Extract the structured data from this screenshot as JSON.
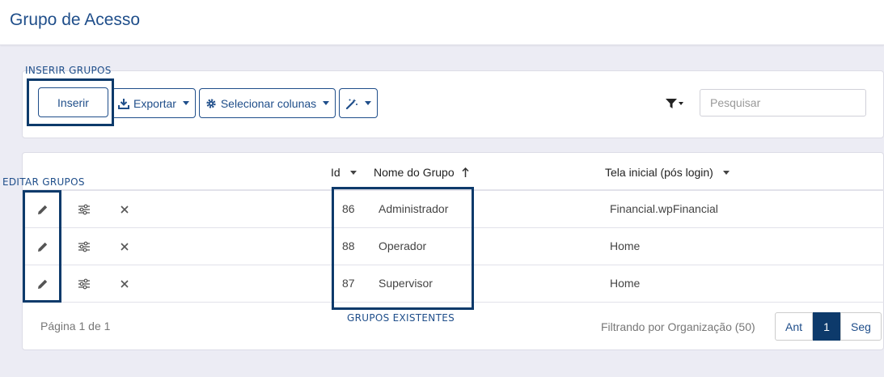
{
  "header": {
    "title": "Grupo de Acesso"
  },
  "annotations": {
    "insert": "INSERIR GRUPOS",
    "edit": "EDITAR GRUPOS",
    "existing": "GRUPOS EXISTENTES"
  },
  "toolbar": {
    "insert_label": "Inserir",
    "export_label": "Exportar",
    "columns_label": "Selecionar colunas",
    "search_placeholder": "Pesquisar"
  },
  "table": {
    "columns": {
      "id": "Id",
      "name": "Nome do Grupo",
      "home": "Tela inicial (pós login)"
    },
    "rows": [
      {
        "id": "86",
        "name": "Administrador",
        "home": "Financial.wpFinancial"
      },
      {
        "id": "88",
        "name": "Operador",
        "home": "Home"
      },
      {
        "id": "87",
        "name": "Supervisor",
        "home": "Home"
      }
    ]
  },
  "footer": {
    "page_info": "Página 1 de 1",
    "filter_info": "Filtrando por Organização (50)",
    "prev": "Ant",
    "current": "1",
    "next": "Seg"
  },
  "colors": {
    "primary": "#1f4e8a",
    "annotation": "#0d3a6b"
  }
}
